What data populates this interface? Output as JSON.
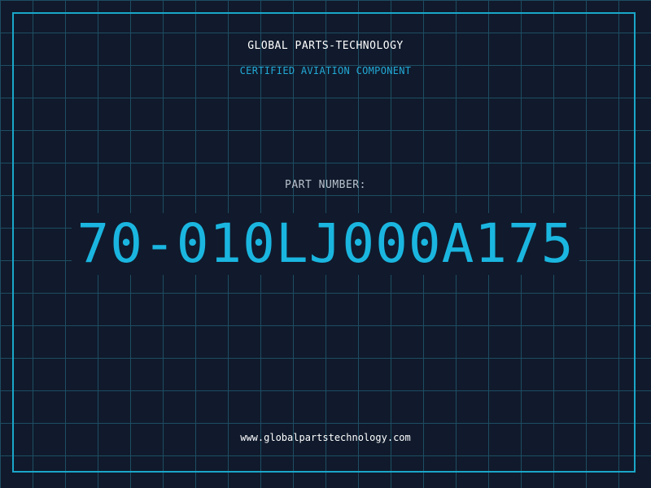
{
  "header": {
    "brand": "GLOBAL PARTS-TECHNOLOGY",
    "subtitle": "CERTIFIED AVIATION COMPONENT"
  },
  "part": {
    "label": "PART NUMBER:",
    "number": "70-010LJ000A175"
  },
  "footer": {
    "website": "www.globalpartstechnology.com"
  },
  "colors": {
    "background": "#101a2c",
    "grid": "#1e4d62",
    "frame": "#1aa6c8",
    "accent": "#1ab6e0",
    "label": "#b9c2cc",
    "text": "#ffffff"
  }
}
